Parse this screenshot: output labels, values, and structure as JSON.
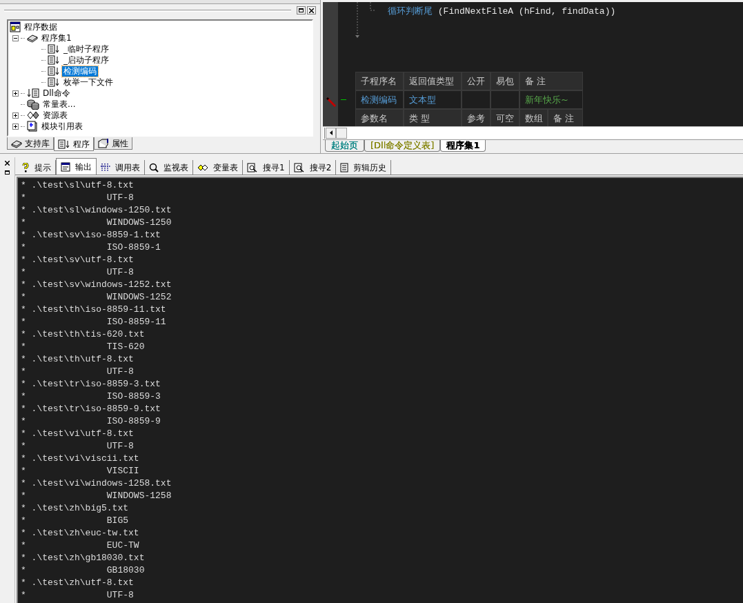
{
  "project_panel": {
    "tree": [
      {
        "label": "程序数据",
        "selected": false,
        "children": [
          {
            "label": "程序集1",
            "expanded": true,
            "selected": false,
            "children": [
              {
                "label": "_临时子程序",
                "selected": false
              },
              {
                "label": "_启动子程序",
                "selected": false
              },
              {
                "label": "检测编码",
                "selected": true
              },
              {
                "label": "枚举一下文件",
                "selected": false
              }
            ]
          },
          {
            "label": "Dll命令",
            "expanded": false,
            "selected": false
          },
          {
            "label": "常量表...",
            "selected": false
          },
          {
            "label": "资源表",
            "expanded": false,
            "selected": false
          },
          {
            "label": "模块引用表",
            "expanded": false,
            "selected": false
          }
        ]
      }
    ],
    "tabs": [
      {
        "label": "支持库",
        "selected": false
      },
      {
        "label": "程序",
        "selected": true
      },
      {
        "label": "属性",
        "selected": false
      }
    ]
  },
  "editor": {
    "code_line": {
      "keyword": "循环判断尾",
      "args": "(FindNextFileA (hFind, findData))"
    },
    "sub_table": {
      "header": [
        "子程序名",
        "返回值类型",
        "公开",
        "易包",
        "备 注"
      ],
      "row": {
        "name": "检测编码",
        "type": "文本型",
        "comment": "新年快乐~"
      },
      "param_header": [
        "参数名",
        "类 型",
        "参考",
        "可空",
        "数组",
        "备 注"
      ]
    },
    "tabs": [
      {
        "label": "起始页",
        "color": "#008080",
        "selected": false
      },
      {
        "label": "[Dll命令定义表]",
        "color": "#808000",
        "selected": false
      },
      {
        "label": "程序集1",
        "color": "#000000",
        "selected": true
      }
    ]
  },
  "output_panel": {
    "tabs": [
      {
        "label": "提示",
        "selected": false
      },
      {
        "label": "输出",
        "selected": true
      },
      {
        "label": "调用表",
        "selected": false
      },
      {
        "label": "监视表",
        "selected": false
      },
      {
        "label": "变量表",
        "selected": false
      },
      {
        "label": "搜寻1",
        "selected": false
      },
      {
        "label": "搜寻2",
        "selected": false
      },
      {
        "label": "剪辑历史",
        "selected": false
      }
    ],
    "lines": [
      "* .\\test\\sl\\utf-8.txt",
      "*               UTF-8",
      "* .\\test\\sl\\windows-1250.txt",
      "*               WINDOWS-1250",
      "* .\\test\\sv\\iso-8859-1.txt",
      "*               ISO-8859-1",
      "* .\\test\\sv\\utf-8.txt",
      "*               UTF-8",
      "* .\\test\\sv\\windows-1252.txt",
      "*               WINDOWS-1252",
      "* .\\test\\th\\iso-8859-11.txt",
      "*               ISO-8859-11",
      "* .\\test\\th\\tis-620.txt",
      "*               TIS-620",
      "* .\\test\\th\\utf-8.txt",
      "*               UTF-8",
      "* .\\test\\tr\\iso-8859-3.txt",
      "*               ISO-8859-3",
      "* .\\test\\tr\\iso-8859-9.txt",
      "*               ISO-8859-9",
      "* .\\test\\vi\\utf-8.txt",
      "*               UTF-8",
      "* .\\test\\vi\\viscii.txt",
      "*               VISCII",
      "* .\\test\\vi\\windows-1258.txt",
      "*               WINDOWS-1258",
      "* .\\test\\zh\\big5.txt",
      "*               BIG5",
      "* .\\test\\zh\\euc-tw.txt",
      "*               EUC-TW",
      "* .\\test\\zh\\gb18030.txt",
      "*               GB18030",
      "* .\\test\\zh\\utf-8.txt",
      "*               UTF-8"
    ]
  }
}
